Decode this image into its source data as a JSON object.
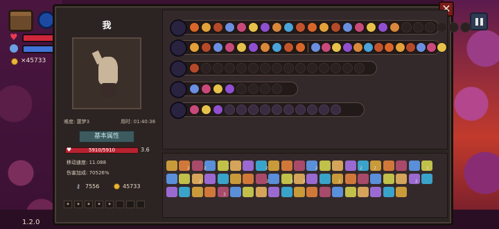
{
  "hud": {
    "coins": "×45733",
    "version": "1.2.0"
  },
  "character": {
    "name": "我",
    "difficulty": "难度: 噩梦3",
    "time": "用时: 01:40:38",
    "attr_button": "基本属性",
    "hp": "5910/5910",
    "armor": "3.6",
    "move_speed": "移动速度: 11.088",
    "damage_bonus": "伤害加成: 70526%",
    "keys": "7556",
    "gold": "45733",
    "slot_labels": [
      "",
      "",
      " ",
      "",
      "",
      "",
      "",
      ""
    ]
  },
  "colors": {
    "panel": "#2c2422",
    "accent_red": "#b72331",
    "gold": "#e7b63a"
  },
  "weapon_rows": [
    {
      "icon": "chest-weapon-icon",
      "orbs": 18,
      "filled": 18,
      "empty": 6
    },
    {
      "icon": "purple-staff-icon",
      "orbs": 10,
      "filled": 10,
      "empty": 0,
      "second_group": 13
    },
    {
      "icon": "magic-wand-icon",
      "orbs": 1,
      "filled": 1,
      "empty": 14
    },
    {
      "icon": "golden-star-icon",
      "orbs": 4,
      "filled": 4,
      "empty": 4
    },
    {
      "icon": "purple-orb-icon",
      "orbs": 13,
      "filled": 3,
      "ghost": 10
    }
  ],
  "item_counts": [
    "2",
    "2",
    "2",
    "2",
    "2",
    "2",
    "3",
    "2",
    "2",
    "3",
    "2",
    "2",
    "2",
    "3"
  ],
  "icons": {
    "close": "close-icon",
    "pause": "pause-icon"
  }
}
